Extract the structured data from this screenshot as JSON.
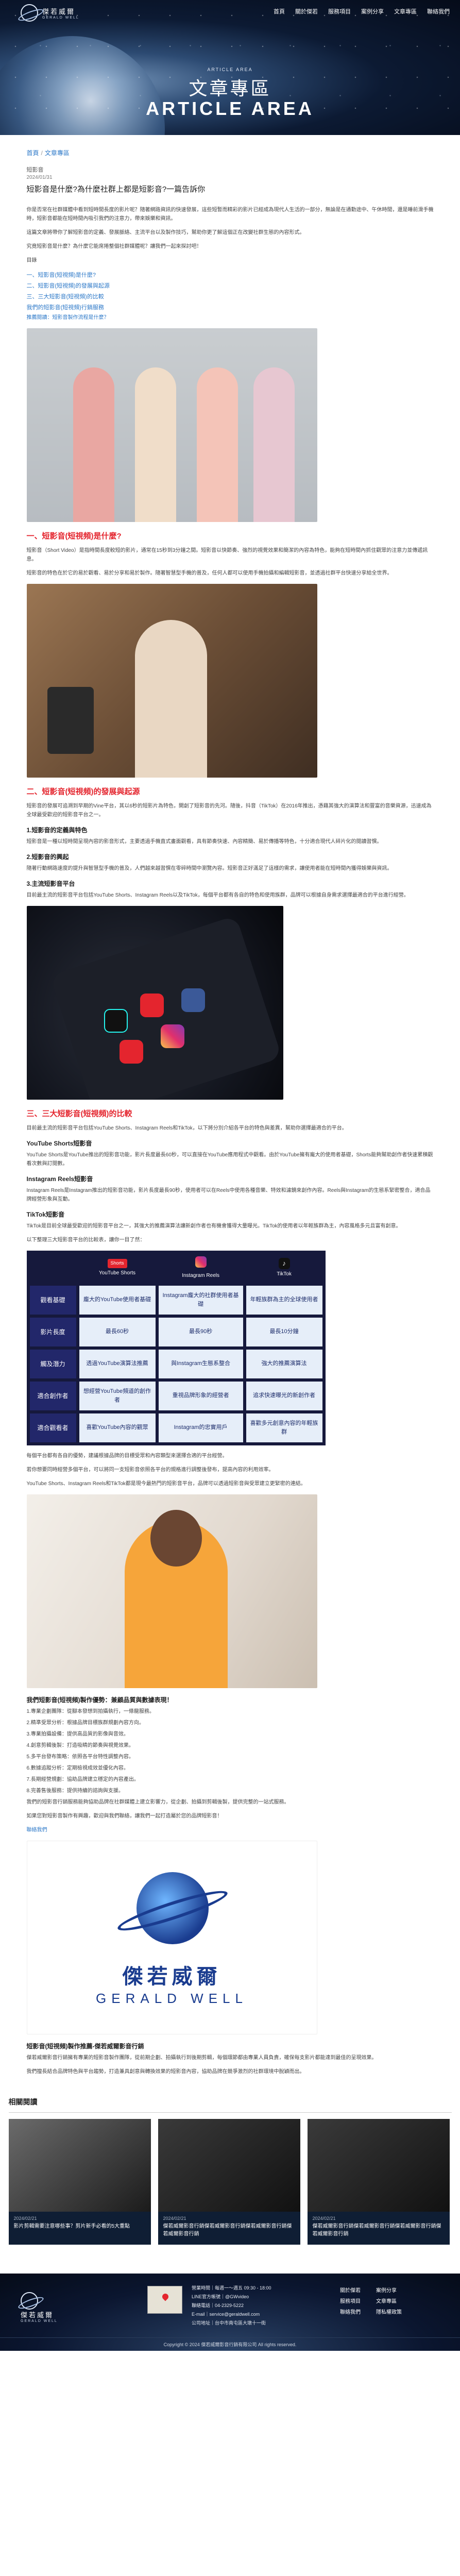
{
  "site": {
    "logo_text": "傑若威爾",
    "logo_sub": "GERALD WELL",
    "nav": [
      "首頁",
      "關於傑若",
      "服務項目",
      "案例分享",
      "文章專區",
      "聯絡我們"
    ]
  },
  "hero": {
    "small": "ARTICLE AREA",
    "title": "文章專區",
    "en": "ARTICLE AREA"
  },
  "breadcrumb": [
    "首頁",
    "文章專區"
  ],
  "article": {
    "category": "短影音",
    "date": "2024/01/31",
    "title": "短影音是什麼?為什麼社群上都是短影音?一篇告訴你",
    "intro": [
      "你是否常在社群媒體中看到短時間長度的影片呢？隨著網路資訊的快速發展，這些短暫而精彩的影片已經成為現代人生活的一部分，無論是在通勤途中、午休時間，還是睡前滑手機時，短影音都能在短時間內吸引我們的注意力，帶來娛樂和資訊。",
      "這篇文章將帶你了解短影音的定義、發展脈絡、主流平台以及製作技巧，幫助你更了解這個正在改變社群生態的內容形式。",
      "究竟短影音是什麼？為什麼它能席捲整個社群媒體呢？讓我們一起來探討吧！"
    ],
    "toc_heading": "目錄",
    "toc": [
      {
        "label": "一、短影音(短視頻)是什麼?",
        "level": 1
      },
      {
        "label": "二、短影音(短視頻)的發展與起源",
        "level": 1
      },
      {
        "label": "三、三大短影音(短視頻)的比較",
        "level": 1
      },
      {
        "label": "我們的短影音(短視頻)行銷服務",
        "level": 1
      }
    ],
    "recommend": "推薦閱讀：短影音製作流程是什麼？"
  },
  "s1": {
    "heading": "一、短影音(短視頻)是什麼?",
    "p": [
      "短影音（Short Video）是指時間長度較短的影片，通常在15秒到3分鐘之間。短影音以快節奏、強烈的視覺效果和簡潔的內容為特色，能夠在短時間內抓住觀眾的注意力並傳遞訊息。",
      "短影音的特色在於它的易於觀看、易於分享和易於製作。隨著智慧型手機的普及，任何人都可以使用手機拍攝和編輯短影音，並透過社群平台快速分享給全世界。"
    ]
  },
  "s2": {
    "heading": "二、短影音(短視頻)的發展與起源",
    "p": [
      "短影音的發展可追溯到早期的Vine平台，其以6秒的短影片為特色，開創了短影音的先河。隨後，抖音（TikTok）在2016年推出，憑藉其強大的演算法和豐富的音樂資源，迅速成為全球最受歡迎的短影音平台之一。"
    ],
    "sub": [
      {
        "heading": "1.短影音的定義與特色",
        "text": "短影音是一種以短時間呈現內容的影音形式，主要透過手機直式畫面觀看，具有節奏快速、內容精簡、易於傳播等特色，十分適合現代人碎片化的閱讀習慣。"
      },
      {
        "heading": "2.短影音的興起",
        "text": "隨著行動網路速度的提升與智慧型手機的普及，人們越來越習慣在零碎時間中瀏覽內容。短影音正好滿足了這樣的需求，讓使用者能在短時間內獲得娛樂與資訊。"
      },
      {
        "heading": "3.主流短影音平台",
        "text": "目前最主流的短影音平台包括YouTube Shorts、Instagram Reels以及TikTok，每個平台都有各自的特色和使用族群，品牌可以根據自身需求選擇最適合的平台進行經營。"
      }
    ]
  },
  "s3": {
    "heading": "三、三大短影音(短視頻)的比較",
    "intro": "目前最主流的短影音平台包括YouTube Shorts、Instagram Reels和TikTok，以下將分別介紹各平台的特色與差異，幫助你選擇最適合的平台。",
    "platforms": [
      {
        "heading": "YouTube Shorts短影音",
        "text": "YouTube Shorts是YouTube推出的短影音功能，影片長度最長60秒，可以直接在YouTube應用程式中觀看。由於YouTube擁有龐大的使用者基礎，Shorts能夠幫助創作者快速累積觀看次數與訂閱數。"
      },
      {
        "heading": "Instagram Reels短影音",
        "text": "Instagram Reels是Instagram推出的短影音功能，影片長度最長90秒，使用者可以在Reels中使用各種音樂、特效和濾鏡來創作內容。Reels與Instagram的生態系緊密整合，適合品牌經營形象與互動。"
      },
      {
        "heading": "TikTok短影音",
        "text": "TikTok是目前全球最受歡迎的短影音平台之一，其強大的推薦演算法讓新創作者也有機會獲得大量曝光。TikTok的使用者以年輕族群為主，內容風格多元且富有創意。"
      }
    ],
    "table_intro": "以下整理三大短影音平台的比較表，讓你一目了然："
  },
  "compare": {
    "columns": [
      "YouTube Shorts",
      "Instagram Reels",
      "TikTok"
    ],
    "rows": [
      {
        "label": "觀看基礎",
        "cells": [
          "龐大的YouTube使用者基礎",
          "Instagram龐大的社群使用者基礎",
          "年輕族群為主的全球使用者"
        ]
      },
      {
        "label": "影片長度",
        "cells": [
          "最長60秒",
          "最長90秒",
          "最長10分鐘"
        ]
      },
      {
        "label": "觸及潛力",
        "cells": [
          "透過YouTube演算法推薦",
          "與Instagram生態系整合",
          "強大的推薦演算法"
        ]
      },
      {
        "label": "適合創作者",
        "cells": [
          "想經營YouTube頻道的創作者",
          "重視品牌形象的經營者",
          "追求快速曝光的新創作者"
        ]
      },
      {
        "label": "適合觀看者",
        "cells": [
          "喜歡YouTube內容的觀眾",
          "Instagram的忠實用戶",
          "喜歡多元創意內容的年輕族群"
        ]
      }
    ]
  },
  "s3b": {
    "p": [
      "每個平台都有各自的優勢，建議根據品牌的目標受眾和內容類型來選擇合適的平台經營。",
      "若你想要同時經營多個平台，可以將同一支短影音依照各平台的規格進行調整後發布，提高內容的利用效率。",
      "YouTube Shorts、Instagram Reels和TikTok都是現今最熱門的短影音平台，品牌可以透過短影音與受眾建立更緊密的連結。"
    ]
  },
  "s4": {
    "heading": "我們短影音(短視頻)製作優勢：兼顧品質與數據表現！",
    "items": [
      "1.專業企劃團隊：從腳本發想到拍攝執行，一條龍服務。",
      "2.精準受眾分析：根據品牌目標族群規劃內容方向。",
      "3.專業拍攝設備：提供高品質的影像與音效。",
      "4.創意剪輯後製：打造吸睛的節奏與視覺效果。",
      "5.多平台發布策略：依照各平台特性調整內容。",
      "6.數據追蹤分析：定期檢視成效並優化內容。",
      "7.長期經營規劃：協助品牌建立穩定的內容產出。",
      "8.完善售後服務：提供持續的諮詢與支援。"
    ],
    "p": [
      "我們的短影音行銷服務能夠協助品牌在社群媒體上建立影響力，從企劃、拍攝到剪輯後製，提供完整的一站式服務。",
      "如果您對短影音製作有興趣，歡迎與我們聯絡，讓我們一起打造屬於您的品牌短影音！"
    ],
    "link_text": "聯絡我們"
  },
  "s5": {
    "heading": "短影音(短視頻)製作推薦-傑若威爾影音行銷",
    "p": [
      "傑若威爾影音行銷擁有專業的短影音製作團隊，從前期企劃、拍攝執行到後期剪輯，每個環節都由專業人員負責，確保每支影片都能達到最佳的呈現效果。",
      "我們擅長結合品牌特色與平台趨勢，打造兼具創意與轉換效果的短影音內容，協助品牌在競爭激烈的社群環境中脫穎而出。"
    ]
  },
  "logo_card": {
    "cn": "傑若威爾",
    "en": "GERALD WELL"
  },
  "related": {
    "heading": "相關閱讀",
    "cards": [
      {
        "date": "2024/02/21",
        "title": "影片剪輯需要注意哪些事？剪片新手必看的5大重點"
      },
      {
        "date": "2024/02/21",
        "title": "傑若威爾影音行銷傑若威爾影音行銷傑若威爾影音行銷傑若威爾影音行銷"
      },
      {
        "date": "2024/02/21",
        "title": "傑若威爾影音行銷傑若威爾影音行銷傑若威爾影音行銷傑若威爾影音行銷"
      }
    ]
  },
  "footer": {
    "info": [
      "營業時間｜每週一～週五 09:30 - 18:00",
      "LINE官方帳號｜@GWvideo",
      "聯絡電話｜04-2329-5222",
      "E-mail｜service@geraldwell.com",
      "公司地址｜台中市南屯區大墩十一街"
    ],
    "nav": [
      "關於傑若",
      "案例分享",
      "服務項目",
      "文章專區",
      "聯絡我們",
      "隱私權政策"
    ],
    "copyright": "Copyright © 2024 傑若威爾影音行銷有限公司 All rights reserved."
  }
}
